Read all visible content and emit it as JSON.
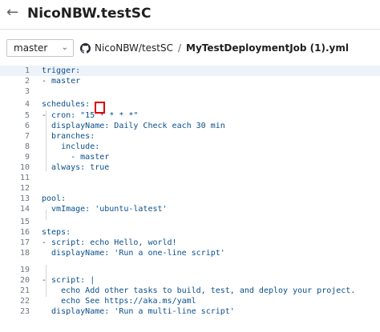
{
  "header": {
    "back_icon": "arrow-left-icon",
    "title": "NicoNBW.testSC"
  },
  "toolbar": {
    "branch": "master",
    "repo_icon": "github-icon",
    "repo": "NicoNBW/testSC",
    "separator": "/",
    "file": "MyTestDeploymentJob (1).yml"
  },
  "editor": {
    "lines": [
      {
        "n": "1",
        "text": "trigger:"
      },
      {
        "n": "2",
        "text": "- master"
      },
      {
        "n": "3",
        "text": ""
      },
      {
        "n": "4",
        "text": "schedules:"
      },
      {
        "n": "5",
        "text": "- cron: \"15 * * * *\""
      },
      {
        "n": "6",
        "text": "  displayName: Daily Check each 30 min"
      },
      {
        "n": "7",
        "text": "  branches:"
      },
      {
        "n": "8",
        "text": "    include:"
      },
      {
        "n": "9",
        "text": "      - master"
      },
      {
        "n": "10",
        "text": "  always: true"
      },
      {
        "n": "11",
        "text": ""
      },
      {
        "n": "12",
        "text": ""
      },
      {
        "n": "13",
        "text": "pool:"
      },
      {
        "n": "14",
        "text": "  vmImage: 'ubuntu-latest'"
      },
      {
        "n": "15",
        "text": ""
      },
      {
        "n": "16",
        "text": "steps:"
      },
      {
        "n": "17",
        "text": "- script: echo Hello, world!"
      },
      {
        "n": "18",
        "text": "  displayName: 'Run a one-line script'"
      },
      {
        "n": "19",
        "text": ""
      },
      {
        "n": "20",
        "text": "- script: |"
      },
      {
        "n": "21",
        "text": "    echo Add other tasks to build, test, and deploy your project."
      },
      {
        "n": "22",
        "text": "    echo See https://aka.ms/yaml"
      },
      {
        "n": "23",
        "text": "  displayName: 'Run a multi-line script'"
      }
    ]
  },
  "colors": {
    "accent_highlight": "#e00000"
  }
}
